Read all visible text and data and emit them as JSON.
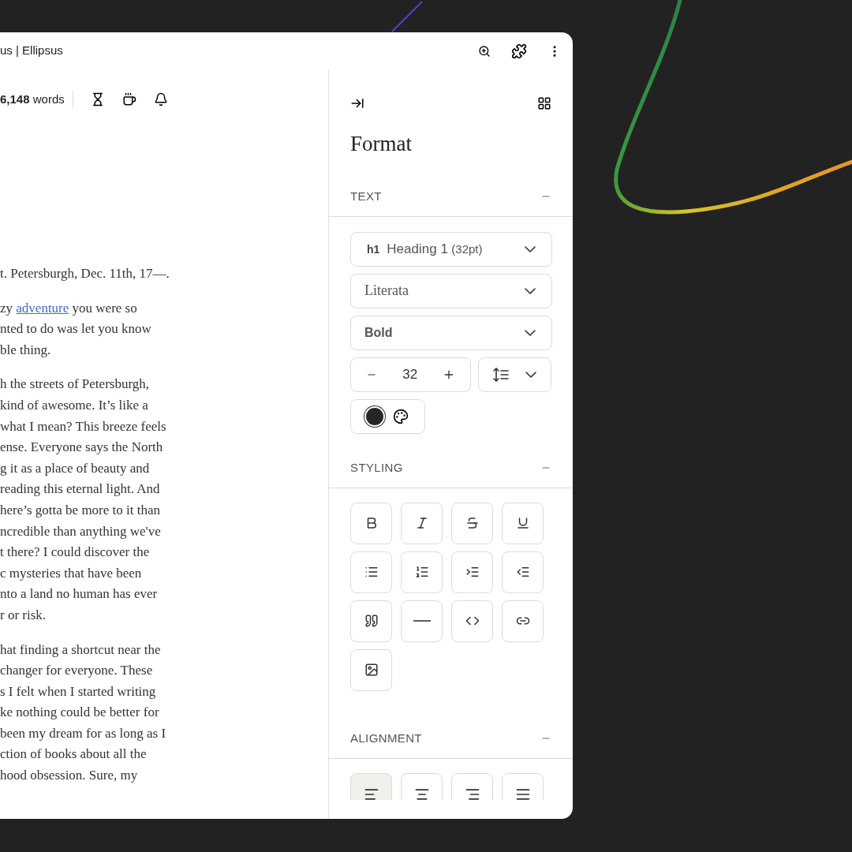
{
  "window": {
    "title": "us | Ellipsus"
  },
  "toolbar": {
    "word_count": "6,148",
    "word_label": "words"
  },
  "document": {
    "paragraphs": [
      {
        "lines": [
          "t. Petersburgh, Dec. 11th, 17—."
        ]
      },
      {
        "lines": [
          [
            {
              "kind": "text",
              "text": "zy "
            },
            {
              "kind": "link",
              "text": "adventure"
            },
            {
              "kind": "text",
              "text": " you were so"
            }
          ],
          "nted to do was let you know",
          "ble thing."
        ]
      },
      {
        "lines": [
          "h the streets of Petersburgh,",
          "kind of awesome. It’s like a",
          "what I mean? This breeze feels",
          "ense. Everyone says the North",
          "g it as a place of beauty and",
          "reading this eternal light. And",
          "here’s gotta be more to it than",
          "ncredible than anything we've",
          "t there? I could discover the",
          "c mysteries that have been",
          "nto a land no human has ever",
          "r or risk."
        ]
      },
      {
        "lines": [
          "hat finding a shortcut near the",
          "changer for everyone. These",
          "s I felt when I started writing",
          "ke nothing could be better for",
          "been my dream for as long as I",
          "ction of books about all the",
          "hood obsession. Sure, my"
        ]
      }
    ]
  },
  "panel": {
    "title": "Format",
    "text_section": {
      "title": "TEXT",
      "expanded": true,
      "block_select": {
        "tag": "h1",
        "label": "Heading 1",
        "detail": "(32pt)"
      },
      "font_select": {
        "value": "Literata"
      },
      "weight_select": {
        "value": "Bold"
      },
      "font_size": "32",
      "text_color": {
        "color": "#262626"
      }
    },
    "styling_section": {
      "title": "STYLING",
      "expanded": true,
      "buttons": [
        {
          "kind": "bold"
        },
        {
          "kind": "italic"
        },
        {
          "kind": "strikethrough"
        },
        {
          "kind": "underline"
        },
        {
          "kind": "bullet-list"
        },
        {
          "kind": "numbered-list"
        },
        {
          "kind": "indent"
        },
        {
          "kind": "outdent"
        },
        {
          "kind": "quote"
        },
        {
          "kind": "divider"
        },
        {
          "kind": "code"
        },
        {
          "kind": "link"
        },
        {
          "kind": "image"
        }
      ]
    },
    "alignment_section": {
      "title": "ALIGNMENT",
      "expanded": true,
      "buttons": [
        {
          "kind": "left",
          "selected": true
        },
        {
          "kind": "center",
          "selected": false
        },
        {
          "kind": "right",
          "selected": false
        },
        {
          "kind": "justify",
          "selected": false
        }
      ]
    }
  }
}
